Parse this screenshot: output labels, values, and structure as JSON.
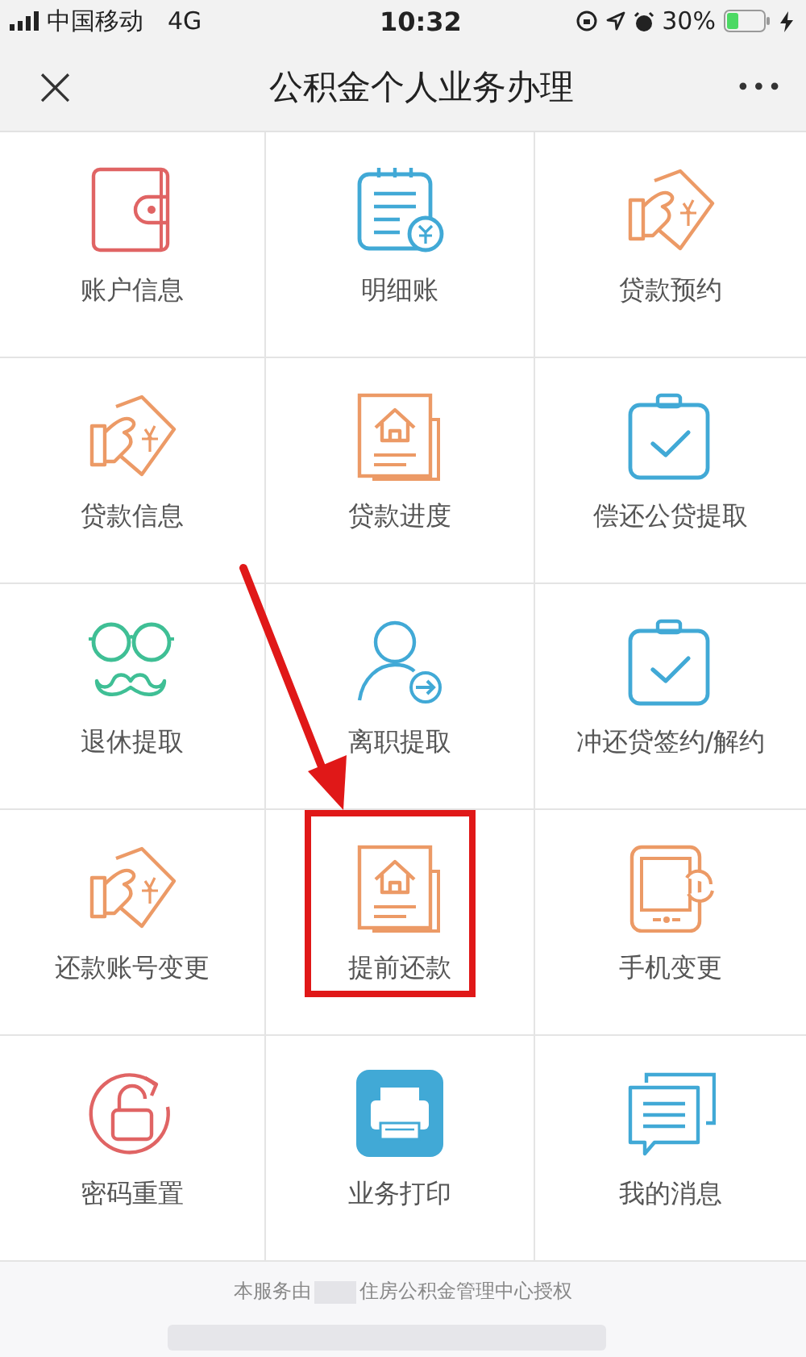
{
  "status_bar": {
    "carrier": "中国移动",
    "network": "4G",
    "time": "10:32",
    "battery": "30%"
  },
  "nav_bar": {
    "close": "×",
    "title": "公积金个人业务办理",
    "more": "•••"
  },
  "services": [
    {
      "label": "账户信息",
      "kind": "wallet",
      "highlighted": false
    },
    {
      "label": "明细账",
      "kind": "ledger",
      "highlighted": false
    },
    {
      "label": "贷款预约",
      "kind": "loan",
      "highlighted": false
    },
    {
      "label": "贷款信息",
      "kind": "loan",
      "highlighted": false
    },
    {
      "label": "贷款进度",
      "kind": "house",
      "highlighted": false
    },
    {
      "label": "偿还公贷提取",
      "kind": "clipboard",
      "highlighted": false
    },
    {
      "label": "退休提取",
      "kind": "glasses",
      "highlighted": false
    },
    {
      "label": "离职提取",
      "kind": "person",
      "highlighted": false
    },
    {
      "label": "冲还贷签约/解约",
      "kind": "clipboard",
      "highlighted": false
    },
    {
      "label": "还款账号变更",
      "kind": "loan",
      "highlighted": false
    },
    {
      "label": "提前还款",
      "kind": "house",
      "highlighted": true
    },
    {
      "label": "手机变更",
      "kind": "phone",
      "highlighted": false
    },
    {
      "label": "密码重置",
      "kind": "unlock",
      "highlighted": false
    },
    {
      "label": "业务打印",
      "kind": "printer",
      "highlighted": false
    },
    {
      "label": "我的消息",
      "kind": "messages",
      "highlighted": false
    }
  ],
  "footer": {
    "text_before": "本服务由",
    "text_after": "住房公积金管理中心授权"
  }
}
